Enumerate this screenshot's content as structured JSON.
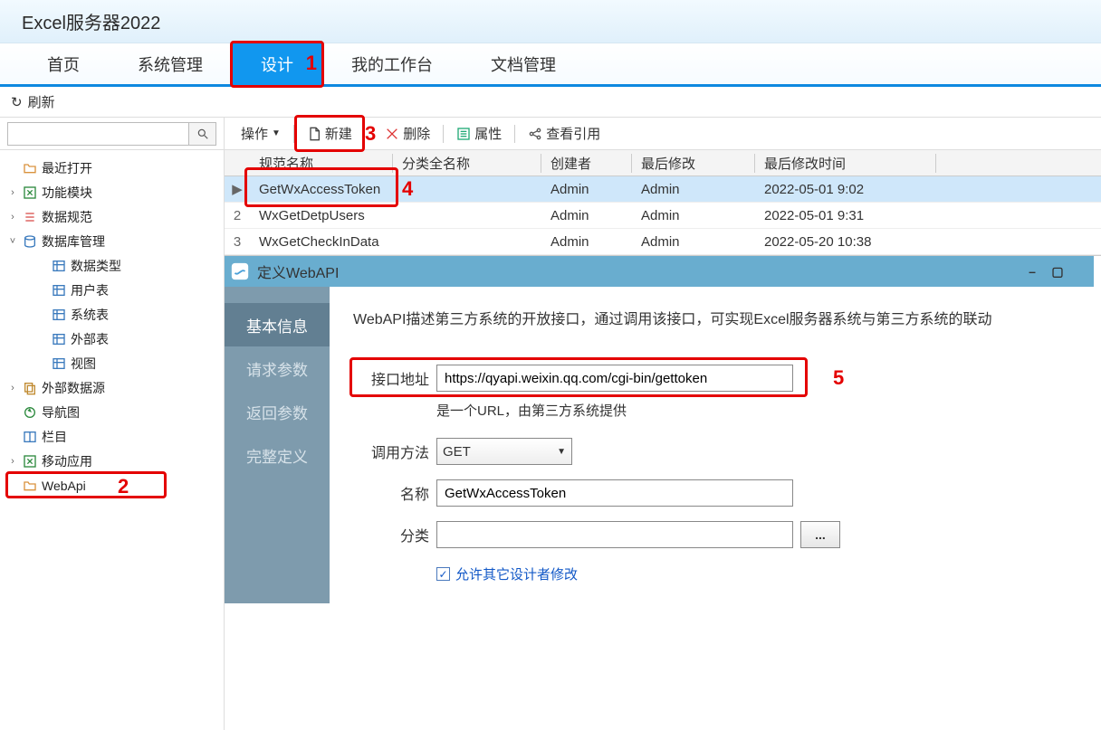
{
  "app": {
    "title": "Excel服务器2022"
  },
  "nav": {
    "items": [
      "首页",
      "系统管理",
      "设计",
      "我的工作台",
      "文档管理"
    ],
    "active_index": 2
  },
  "refresh_label": "刷新",
  "search": {
    "value": ""
  },
  "tree": {
    "nodes": [
      {
        "label": "最近打开",
        "depth": 1,
        "exp": "",
        "icon": "folder"
      },
      {
        "label": "功能模块",
        "depth": 1,
        "exp": "›",
        "icon": "excel"
      },
      {
        "label": "数据规范",
        "depth": 1,
        "exp": "›",
        "icon": "list"
      },
      {
        "label": "数据库管理",
        "depth": 1,
        "exp": "˅",
        "icon": "db"
      },
      {
        "label": "数据类型",
        "depth": 2,
        "exp": "",
        "icon": "table"
      },
      {
        "label": "用户表",
        "depth": 2,
        "exp": "",
        "icon": "table"
      },
      {
        "label": "系统表",
        "depth": 2,
        "exp": "",
        "icon": "table"
      },
      {
        "label": "外部表",
        "depth": 2,
        "exp": "",
        "icon": "table"
      },
      {
        "label": "视图",
        "depth": 2,
        "exp": "",
        "icon": "table"
      },
      {
        "label": "外部数据源",
        "depth": 1,
        "exp": "›",
        "icon": "copy"
      },
      {
        "label": "导航图",
        "depth": 1,
        "exp": "",
        "icon": "nav"
      },
      {
        "label": "栏目",
        "depth": 1,
        "exp": "",
        "icon": "column"
      },
      {
        "label": "移动应用",
        "depth": 1,
        "exp": "›",
        "icon": "excel"
      },
      {
        "label": "WebApi",
        "depth": 1,
        "exp": "",
        "icon": "folder",
        "selected": true
      }
    ]
  },
  "toolbar": {
    "action": "操作",
    "new": "新建",
    "delete": "删除",
    "props": "属性",
    "ref": "查看引用"
  },
  "grid": {
    "headers": [
      "",
      "规范名称",
      "分类全名称",
      "创建者",
      "最后修改",
      "最后修改时间"
    ],
    "rows": [
      {
        "idx": "▶",
        "name": "GetWxAccessToken",
        "cat": "",
        "creator": "Admin",
        "modifier": "Admin",
        "ts": "2022-05-01  9:02",
        "selected": true
      },
      {
        "idx": "2",
        "name": "WxGetDetpUsers",
        "cat": "",
        "creator": "Admin",
        "modifier": "Admin",
        "ts": "2022-05-01  9:31"
      },
      {
        "idx": "3",
        "name": "WxGetCheckInData",
        "cat": "",
        "creator": "Admin",
        "modifier": "Admin",
        "ts": "2022-05-20  10:38"
      }
    ]
  },
  "detail": {
    "panel_title": "定义WebAPI",
    "side_tabs": [
      "基本信息",
      "请求参数",
      "返回参数",
      "完整定义"
    ],
    "side_active": 0,
    "desc": "WebAPI描述第三方系统的开放接口，通过调用该接口，可实现Excel服务器系统与第三方系统的联动",
    "url_label": "接口地址",
    "url_value": "https://qyapi.weixin.qq.com/cgi-bin/gettoken",
    "url_hint": "是一个URL，由第三方系统提供",
    "method_label": "调用方法",
    "method_value": "GET",
    "name_label": "名称",
    "name_value": "GetWxAccessToken",
    "cat_label": "分类",
    "cat_value": "",
    "browse_label": "...",
    "allow_label": "允许其它设计者修改"
  },
  "markers": {
    "m1": "1",
    "m2": "2",
    "m3": "3",
    "m4": "4",
    "m5": "5"
  }
}
